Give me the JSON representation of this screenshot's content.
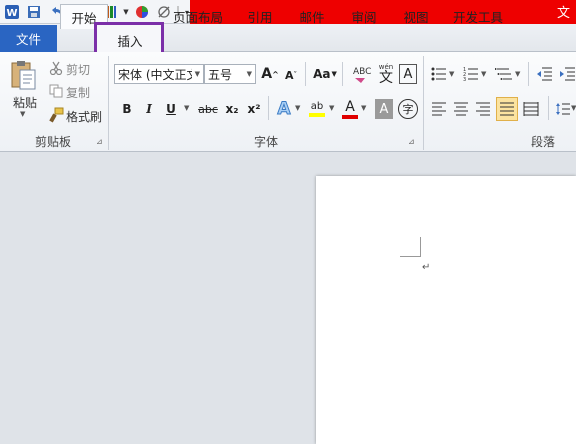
{
  "window": {
    "title_fragment": "文"
  },
  "quick_access": {
    "items": [
      "word-app-icon",
      "save-icon",
      "undo-icon",
      "undo-dropdown-icon",
      "redo-icon",
      "format-painter-icon",
      "color-icon",
      "draw-icon",
      "customize-dropdown-icon"
    ]
  },
  "tabs": {
    "file": "文件",
    "home": "开始",
    "insert": "插入",
    "page_layout": "页面布局",
    "references": "引用",
    "mailings": "邮件",
    "review": "审阅",
    "view": "视图",
    "developer": "开发工具"
  },
  "clipboard": {
    "paste": "粘贴",
    "cut": "剪切",
    "copy": "复制",
    "format_painter": "格式刷",
    "group_label": "剪贴板"
  },
  "font": {
    "font_name": "宋体 (中文正文",
    "font_size": "五号",
    "grow": "A",
    "shrink": "A",
    "change_case": "Aa",
    "bold": "B",
    "italic": "I",
    "underline": "U",
    "strike": "abc",
    "subscript": "x₂",
    "superscript": "x²",
    "text_effect": "A",
    "highlight": "ab",
    "font_color": "A",
    "char_shading": "A",
    "enclose": "字",
    "phonetic": "wén",
    "phonetic_char": "文",
    "border_char": "A",
    "group_label": "字体"
  },
  "paragraph": {
    "group_label": "段落"
  },
  "colors": {
    "title_red": "#ee0000",
    "file_tab": "#2a65c2",
    "highlight_box": "#7b2fa8",
    "font_color_bar": "#e00000",
    "highlight_bar": "#ffff00"
  },
  "document": {
    "paragraph_mark": "↵"
  }
}
